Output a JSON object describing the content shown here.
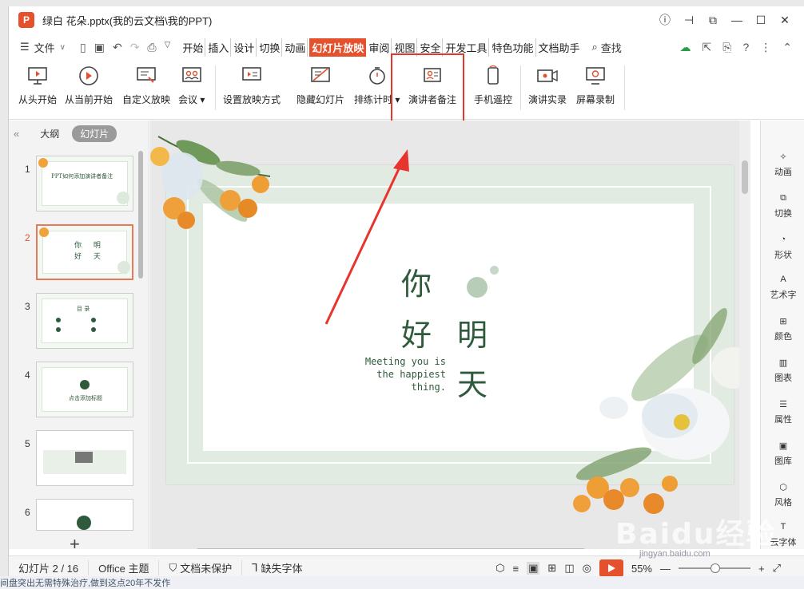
{
  "window": {
    "title": "绿白 花朵.pptx(我的云文档\\我的PPT)",
    "app_icon": "P"
  },
  "menu": {
    "file": "文件",
    "items": [
      "开始",
      "插入",
      "设计",
      "切换",
      "动画",
      "幻灯片放映",
      "审阅",
      "视图",
      "安全",
      "开发工具",
      "特色功能",
      "文档助手"
    ],
    "active": "幻灯片放映",
    "search": "查找"
  },
  "ribbon": {
    "buttons": [
      {
        "label": "从头开始",
        "icon": "monitor-play-icon"
      },
      {
        "label": "从当前开始",
        "icon": "play-circle-icon"
      },
      {
        "label": "自定义放映",
        "icon": "custom-show-icon"
      },
      {
        "label": "会议",
        "icon": "meeting-icon"
      },
      {
        "label": "设置放映方式",
        "icon": "settings-screen-icon"
      },
      {
        "label": "隐藏幻灯片",
        "icon": "hide-slide-icon"
      },
      {
        "label": "排练计时",
        "icon": "timer-icon"
      },
      {
        "label": "演讲者备注",
        "icon": "speaker-notes-icon"
      },
      {
        "label": "手机遥控",
        "icon": "phone-remote-icon"
      },
      {
        "label": "演讲实录",
        "icon": "record-camera-icon"
      },
      {
        "label": "屏幕录制",
        "icon": "screen-record-icon"
      }
    ],
    "highlight_color": "#e8342f"
  },
  "left_panel": {
    "tabs": {
      "outline": "大纲",
      "slides": "幻灯片"
    },
    "thumbnails": [
      {
        "num": "1",
        "text": "PPT如何添加演讲者备注"
      },
      {
        "num": "2",
        "text": "你 明 好 天"
      },
      {
        "num": "3",
        "text": "目 录"
      },
      {
        "num": "4",
        "text": "点击添加标题"
      },
      {
        "num": "5",
        "text": ""
      },
      {
        "num": "6",
        "text": ""
      }
    ],
    "selected": "2"
  },
  "slide": {
    "chars": {
      "ni": "你",
      "hao": "好",
      "ming": "明",
      "tian": "天"
    },
    "tagline": "Meeting you is\nthe happiest\nthing."
  },
  "right_bar": {
    "items": [
      {
        "label": "动画",
        "icon": "animation-icon"
      },
      {
        "label": "切换",
        "icon": "transition-icon"
      },
      {
        "label": "形状",
        "icon": "shape-icon"
      },
      {
        "label": "艺术字",
        "icon": "wordart-icon"
      },
      {
        "label": "颜色",
        "icon": "color-icon"
      },
      {
        "label": "图表",
        "icon": "chart-icon"
      },
      {
        "label": "属性",
        "icon": "properties-icon"
      },
      {
        "label": "图库",
        "icon": "gallery-icon"
      },
      {
        "label": "风格",
        "icon": "style-icon"
      },
      {
        "label": "云字体",
        "icon": "cloud-font-icon"
      }
    ]
  },
  "status": {
    "slide_info": "幻灯片 2 / 16",
    "theme": "Office 主题",
    "protect": "文档未保护",
    "missing_font": "缺失字体",
    "zoom": "55%"
  },
  "watermark": {
    "brand": "Baidu经验",
    "url": "jingyan.baidu.com"
  },
  "bottom_strip": "间盘突出无需特殊治疗,做到这点20年不发作"
}
